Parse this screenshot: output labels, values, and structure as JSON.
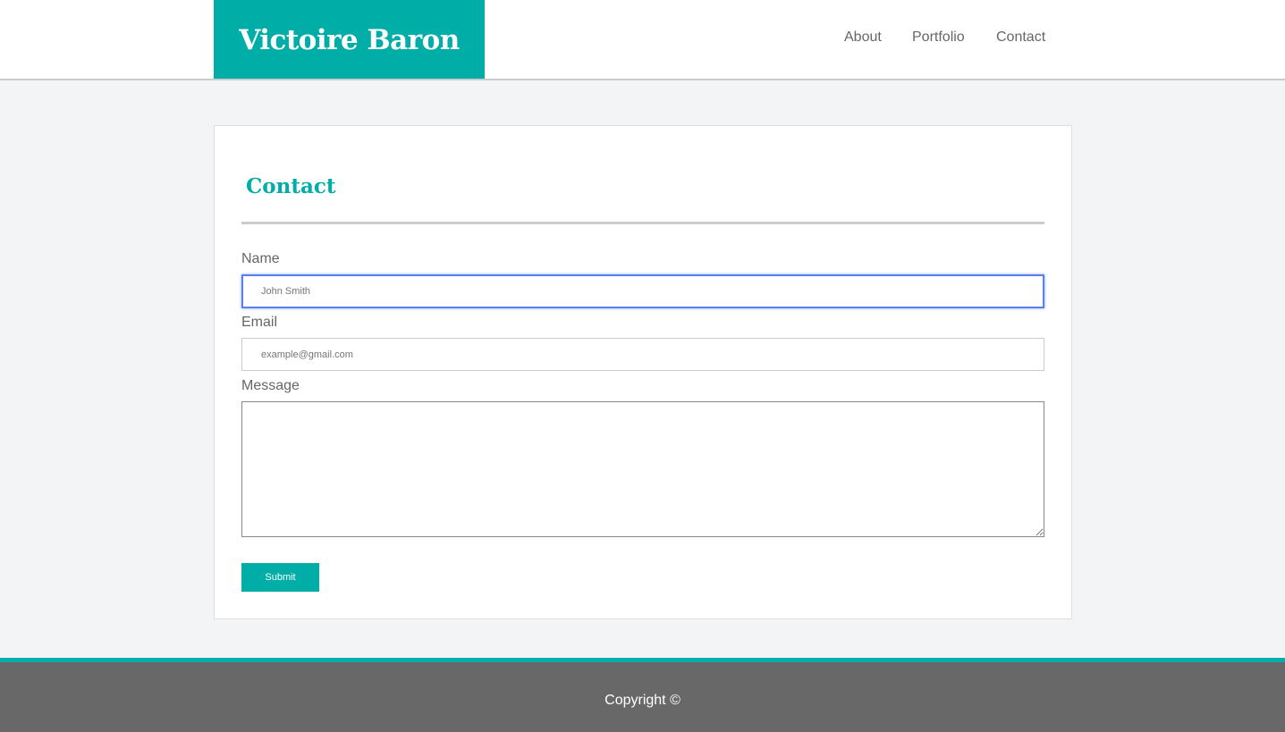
{
  "header": {
    "logo": "Victoire Baron",
    "nav": [
      {
        "label": "About"
      },
      {
        "label": "Portfolio"
      },
      {
        "label": "Contact"
      }
    ]
  },
  "contact": {
    "title": "Contact",
    "name_label": "Name",
    "name_placeholder": "John Smith",
    "email_label": "Email",
    "email_placeholder": "example@gmail.com",
    "message_label": "Message",
    "submit_label": "Submit"
  },
  "footer": {
    "copyright": "Copyright ©"
  },
  "colors": {
    "accent": "#00aea7",
    "footer": "#686868",
    "focus": "#5b7ff0"
  }
}
